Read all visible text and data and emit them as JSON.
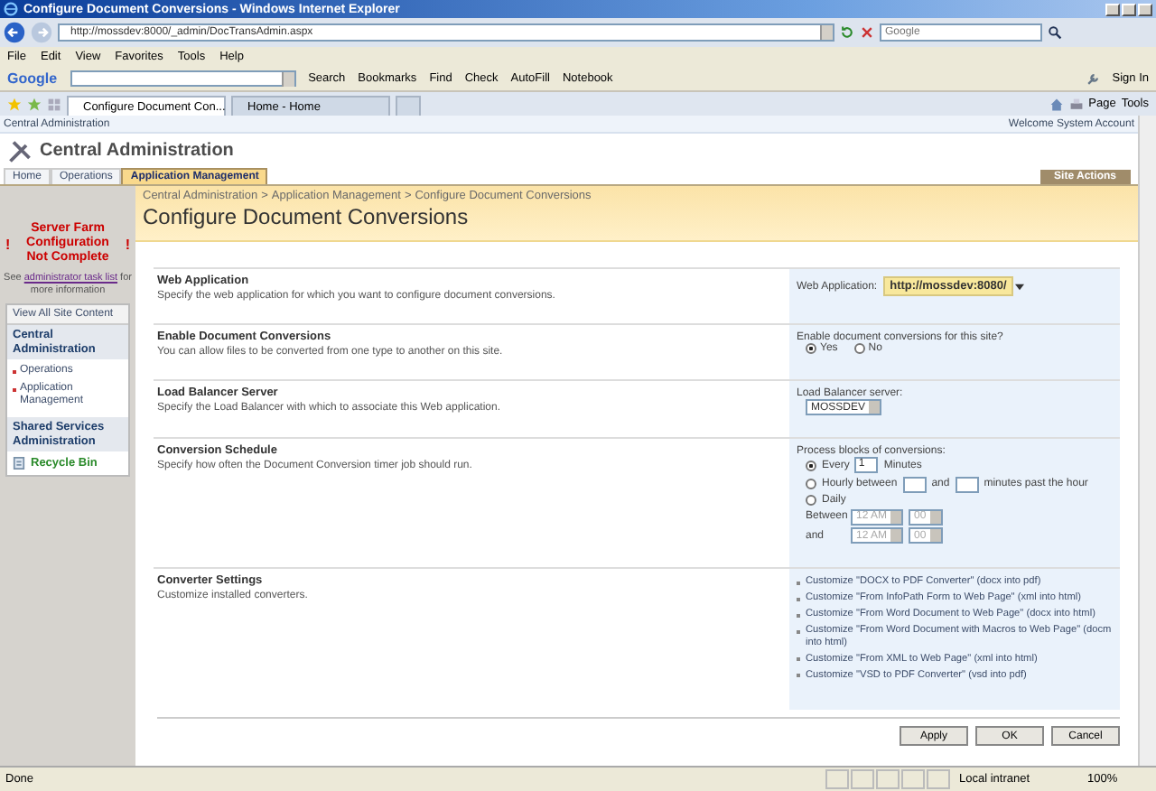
{
  "window": {
    "title": "Configure Document Conversions - Windows Internet Explorer"
  },
  "address": {
    "url": "http://mossdev:8000/_admin/DocTransAdmin.aspx",
    "search_placeholder": "Google"
  },
  "menu": [
    "File",
    "Edit",
    "View",
    "Favorites",
    "Tools",
    "Help"
  ],
  "google_toolbar": {
    "logo": "Google",
    "search": "Search",
    "items": [
      "Bookmarks",
      "Find",
      "Check",
      "AutoFill",
      "Notebook"
    ],
    "sign_in": "Sign In"
  },
  "browser_tabs": [
    {
      "label": "Configure Document Con...",
      "selected": true
    },
    {
      "label": "Home - Home",
      "selected": false
    }
  ],
  "command_bar": [
    "Page",
    "Tools"
  ],
  "site": {
    "top_link": "Central Administration",
    "welcome": "Welcome System Account",
    "title": "Central Administration",
    "site_actions": "Site Actions",
    "tabs": [
      {
        "label": "Home",
        "selected": false
      },
      {
        "label": "Operations",
        "selected": false
      },
      {
        "label": "Application Management",
        "selected": true
      }
    ]
  },
  "breadcrumb": {
    "separator": ">",
    "items": [
      "Central Administration",
      "Application Management",
      "Configure Document Conversions"
    ]
  },
  "page_title": "Configure Document Conversions",
  "warning": {
    "mark": "!",
    "title": "Server Farm Configuration Not Complete",
    "before_link": "See",
    "link": "administrator task list",
    "after_link": "for more information"
  },
  "quick_launch": {
    "view_all": "View All Site Content",
    "groups": [
      {
        "heading": "Central Administration",
        "items": [
          "Operations",
          "Application Management"
        ]
      },
      {
        "heading": "Shared Services Administration"
      }
    ],
    "recycle_bin": "Recycle Bin"
  },
  "sections": [
    {
      "kind": "webapp",
      "title": "Web Application",
      "description": "Specify the web application for which you want to configure document conversions.",
      "label": "Web Application:",
      "value": "http://mossdev:8080/"
    },
    {
      "kind": "radio",
      "title": "Enable Document Conversions",
      "description": "You can allow files to be converted from one type to another on this site.",
      "prompt": "Enable document conversions for this site?",
      "options": [
        {
          "label": "Yes",
          "selected": true
        },
        {
          "label": "No",
          "selected": false
        }
      ]
    },
    {
      "kind": "select",
      "title": "Load Balancer Server",
      "description": "Specify the Load Balancer with which to associate this Web application.",
      "label": "Load Balancer server:",
      "value": "MOSSDEV"
    },
    {
      "kind": "schedule",
      "title": "Conversion Schedule",
      "description": "Specify how often the Document Conversion timer job should run.",
      "prompt": "Process blocks of conversions:",
      "every": {
        "label": "Every",
        "value": "1",
        "suffix": "Minutes",
        "selected": true
      },
      "hourly": {
        "label": "Hourly between",
        "and": "and",
        "suffix": "minutes past the hour",
        "selected": false
      },
      "daily": {
        "label": "Daily",
        "selected": false
      },
      "times": [
        {
          "label": "Between",
          "hour": "12 AM",
          "minute": "00",
          "disabled": true
        },
        {
          "label": "and",
          "hour": "12 AM",
          "minute": "00",
          "disabled": true
        }
      ]
    },
    {
      "kind": "links",
      "title": "Converter Settings",
      "description": "Customize installed converters.",
      "links": [
        "Customize \"DOCX to PDF Converter\" (docx into pdf)",
        "Customize \"From InfoPath Form to Web Page\" (xml into html)",
        "Customize \"From Word Document to Web Page\" (docx into html)",
        "Customize \"From Word Document with Macros to Web Page\" (docm into html)",
        "Customize \"From XML to Web Page\" (xml into html)",
        "Customize \"VSD to PDF Converter\" (vsd into pdf)"
      ]
    }
  ],
  "buttons": [
    "Apply",
    "OK",
    "Cancel"
  ],
  "status_bar": {
    "text": "Done",
    "zone": "Local intranet",
    "zoom": "100%"
  }
}
